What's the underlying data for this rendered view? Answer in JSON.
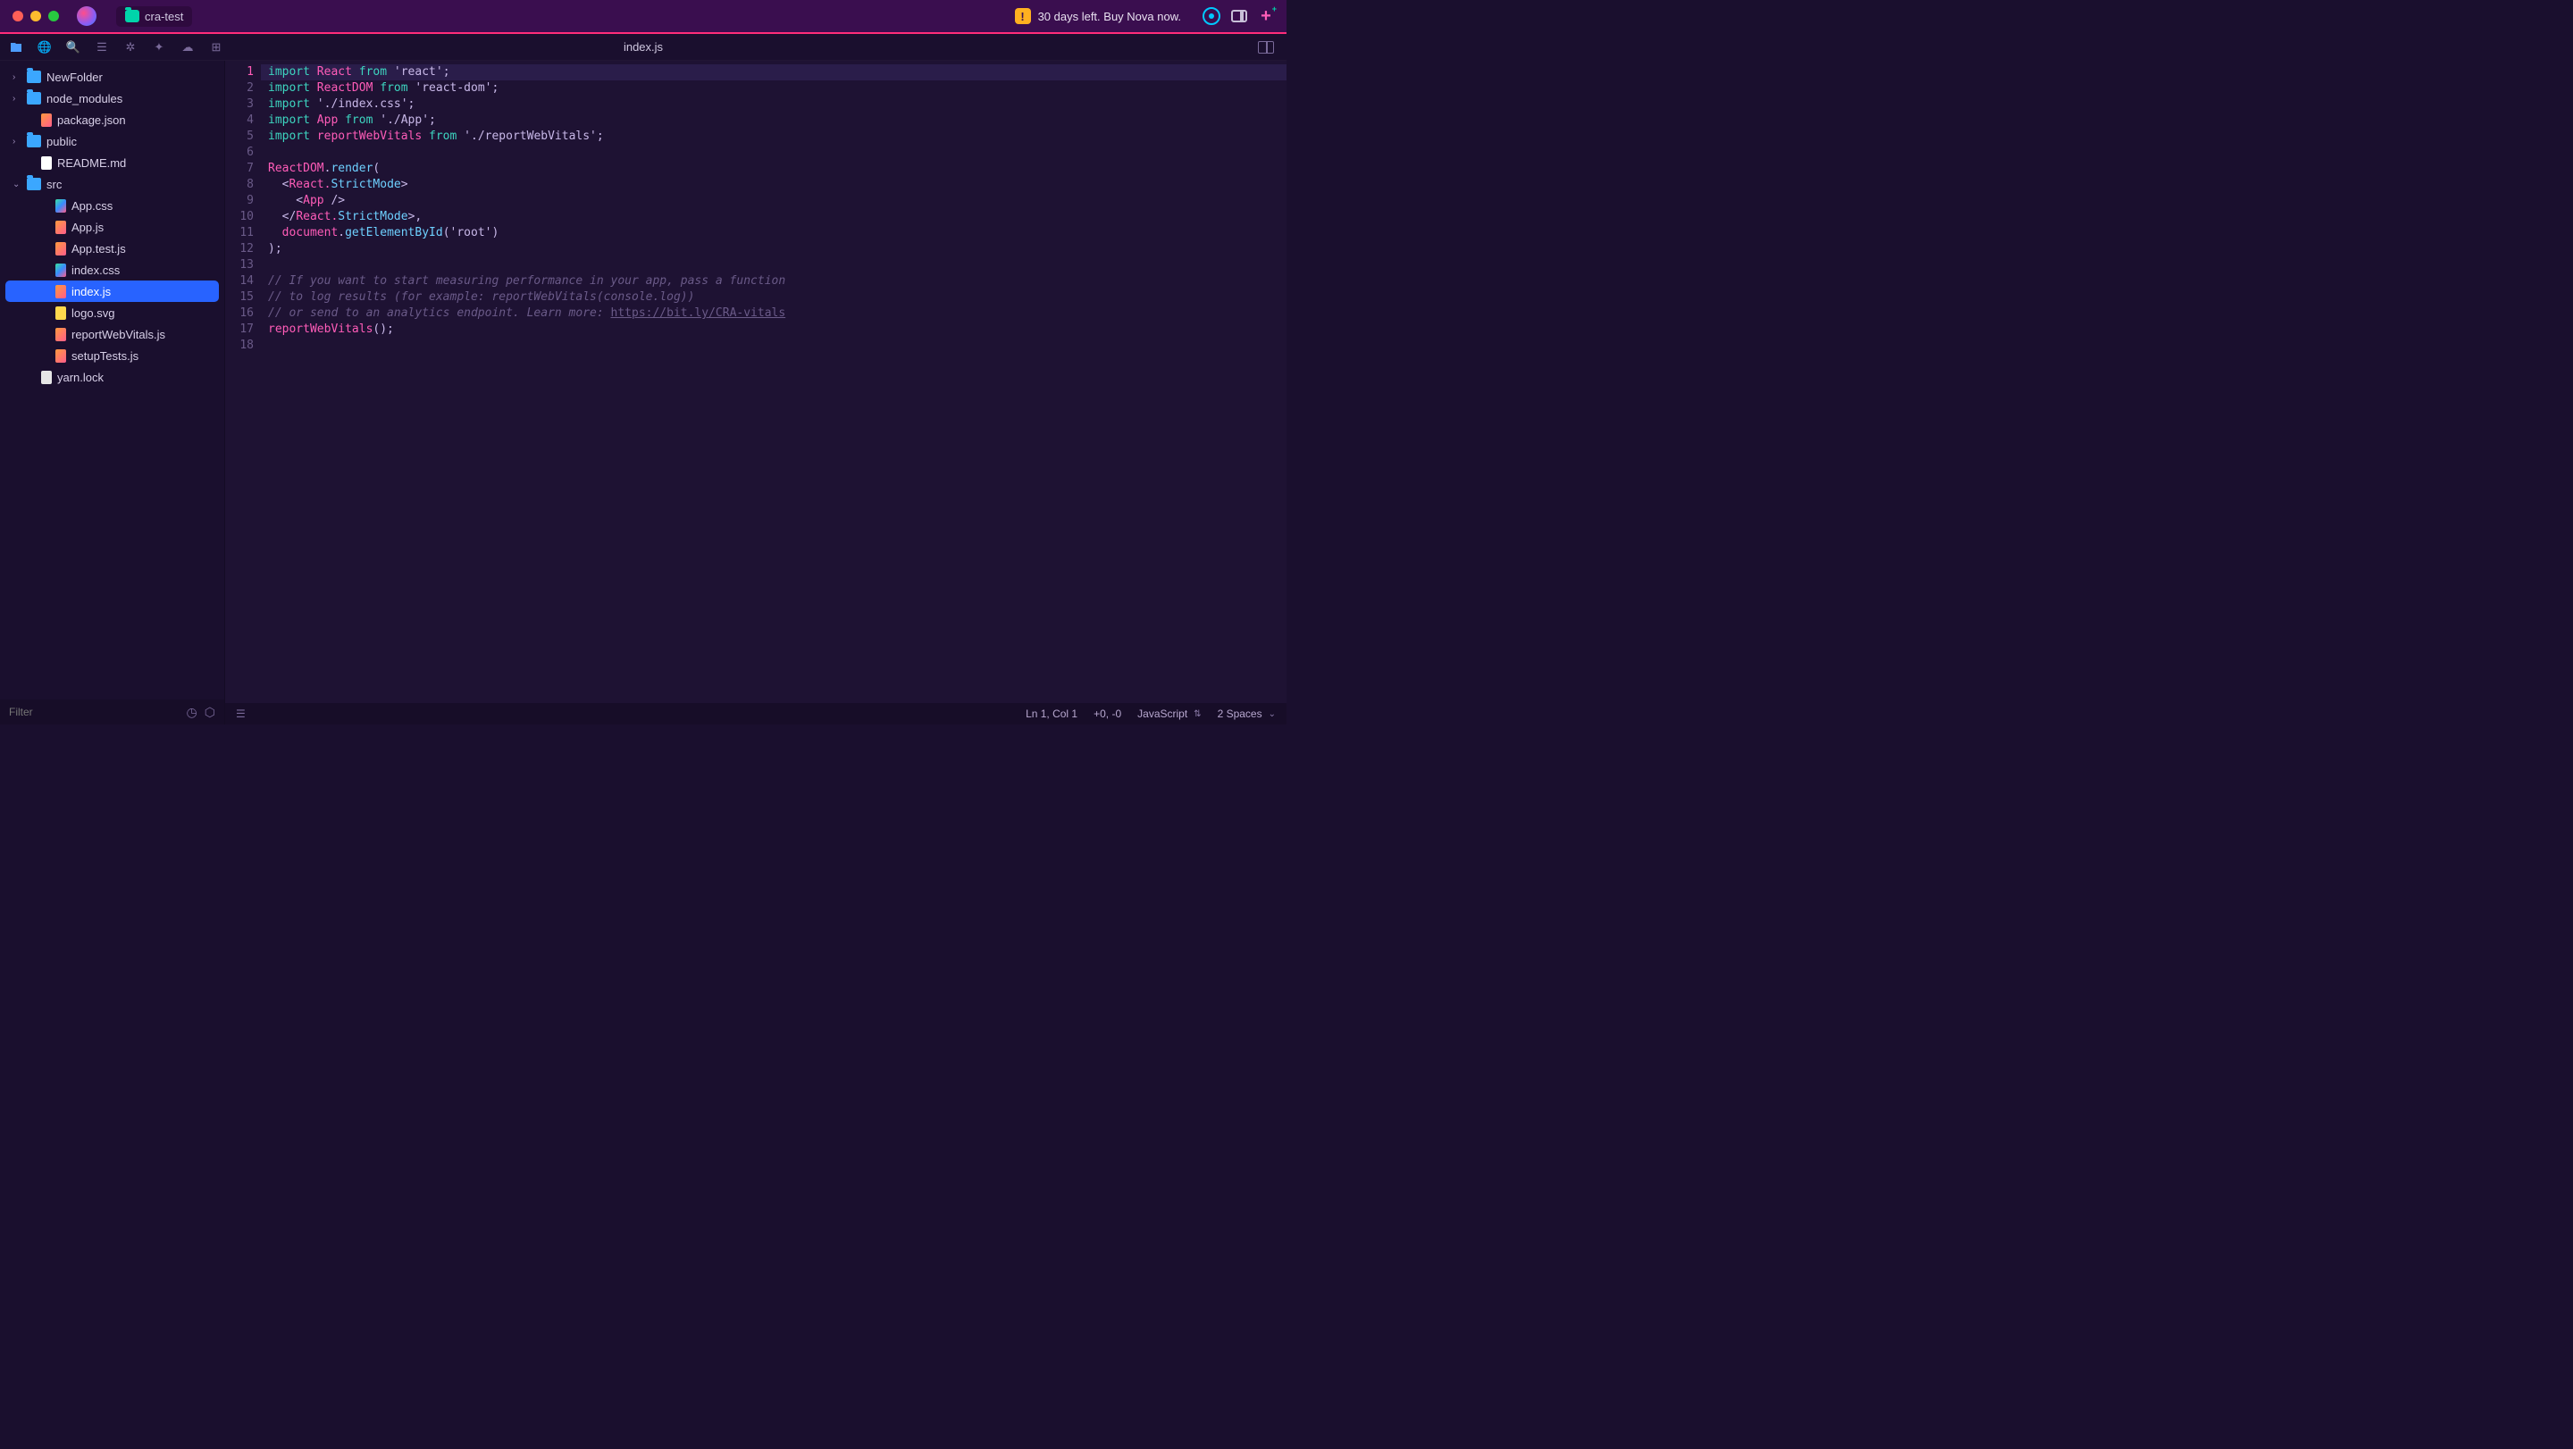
{
  "titlebar": {
    "project_name": "cra-test",
    "trial_text": "30 days left. Buy Nova now."
  },
  "toolbar": {
    "active_tab": "index.js"
  },
  "sidebar": {
    "filter_placeholder": "Filter",
    "tree": [
      {
        "type": "folder",
        "name": "NewFolder",
        "depth": 0,
        "expanded": false,
        "chev": true
      },
      {
        "type": "folder",
        "name": "node_modules",
        "depth": 0,
        "expanded": false,
        "chev": true
      },
      {
        "type": "file",
        "name": "package.json",
        "icon": "js",
        "depth": 1,
        "chev": false
      },
      {
        "type": "folder",
        "name": "public",
        "depth": 0,
        "expanded": false,
        "chev": true
      },
      {
        "type": "file",
        "name": "README.md",
        "icon": "generic",
        "depth": 1,
        "chev": false
      },
      {
        "type": "folder",
        "name": "src",
        "depth": 0,
        "expanded": true,
        "chev": true
      },
      {
        "type": "file",
        "name": "App.css",
        "icon": "css",
        "depth": 2,
        "chev": false
      },
      {
        "type": "file",
        "name": "App.js",
        "icon": "js",
        "depth": 2,
        "chev": false
      },
      {
        "type": "file",
        "name": "App.test.js",
        "icon": "js",
        "depth": 2,
        "chev": false
      },
      {
        "type": "file",
        "name": "index.css",
        "icon": "css",
        "depth": 2,
        "chev": false
      },
      {
        "type": "file",
        "name": "index.js",
        "icon": "js",
        "depth": 2,
        "chev": false,
        "selected": true
      },
      {
        "type": "file",
        "name": "logo.svg",
        "icon": "svg",
        "depth": 2,
        "chev": false
      },
      {
        "type": "file",
        "name": "reportWebVitals.js",
        "icon": "js",
        "depth": 2,
        "chev": false
      },
      {
        "type": "file",
        "name": "setupTests.js",
        "icon": "js",
        "depth": 2,
        "chev": false
      },
      {
        "type": "file",
        "name": "yarn.lock",
        "icon": "lock",
        "depth": 1,
        "chev": false
      }
    ]
  },
  "editor": {
    "line_count": 18,
    "current_line": 1,
    "lines": [
      [
        {
          "c": "k",
          "t": "import"
        },
        {
          "c": "p",
          "t": " "
        },
        {
          "c": "id",
          "t": "React"
        },
        {
          "c": "p",
          "t": " "
        },
        {
          "c": "k",
          "t": "from"
        },
        {
          "c": "p",
          "t": " "
        },
        {
          "c": "str",
          "t": "'react'"
        },
        {
          "c": "p",
          "t": ";"
        }
      ],
      [
        {
          "c": "k",
          "t": "import"
        },
        {
          "c": "p",
          "t": " "
        },
        {
          "c": "id",
          "t": "ReactDOM"
        },
        {
          "c": "p",
          "t": " "
        },
        {
          "c": "k",
          "t": "from"
        },
        {
          "c": "p",
          "t": " "
        },
        {
          "c": "str",
          "t": "'react-dom'"
        },
        {
          "c": "p",
          "t": ";"
        }
      ],
      [
        {
          "c": "k",
          "t": "import"
        },
        {
          "c": "p",
          "t": " "
        },
        {
          "c": "str",
          "t": "'./index.css'"
        },
        {
          "c": "p",
          "t": ";"
        }
      ],
      [
        {
          "c": "k",
          "t": "import"
        },
        {
          "c": "p",
          "t": " "
        },
        {
          "c": "id",
          "t": "App"
        },
        {
          "c": "p",
          "t": " "
        },
        {
          "c": "k",
          "t": "from"
        },
        {
          "c": "p",
          "t": " "
        },
        {
          "c": "str",
          "t": "'./App'"
        },
        {
          "c": "p",
          "t": ";"
        }
      ],
      [
        {
          "c": "k",
          "t": "import"
        },
        {
          "c": "p",
          "t": " "
        },
        {
          "c": "id",
          "t": "reportWebVitals"
        },
        {
          "c": "p",
          "t": " "
        },
        {
          "c": "k",
          "t": "from"
        },
        {
          "c": "p",
          "t": " "
        },
        {
          "c": "str",
          "t": "'./reportWebVitals'"
        },
        {
          "c": "p",
          "t": ";"
        }
      ],
      [],
      [
        {
          "c": "id",
          "t": "ReactDOM"
        },
        {
          "c": "p",
          "t": "."
        },
        {
          "c": "fn",
          "t": "render"
        },
        {
          "c": "p",
          "t": "("
        }
      ],
      [
        {
          "c": "p",
          "t": "  <"
        },
        {
          "c": "tag",
          "t": "React."
        },
        {
          "c": "attr",
          "t": "StrictMode"
        },
        {
          "c": "p",
          "t": ">"
        }
      ],
      [
        {
          "c": "p",
          "t": "    <"
        },
        {
          "c": "tag",
          "t": "App"
        },
        {
          "c": "p",
          "t": " />"
        }
      ],
      [
        {
          "c": "p",
          "t": "  </"
        },
        {
          "c": "tag",
          "t": "React."
        },
        {
          "c": "attr",
          "t": "StrictMode"
        },
        {
          "c": "p",
          "t": ">,"
        }
      ],
      [
        {
          "c": "p",
          "t": "  "
        },
        {
          "c": "id",
          "t": "document"
        },
        {
          "c": "p",
          "t": "."
        },
        {
          "c": "fn",
          "t": "getElementById"
        },
        {
          "c": "p",
          "t": "("
        },
        {
          "c": "str",
          "t": "'root'"
        },
        {
          "c": "p",
          "t": ")"
        }
      ],
      [
        {
          "c": "p",
          "t": ");"
        }
      ],
      [],
      [
        {
          "c": "cm",
          "t": "// If you want to start measuring performance in your app, pass a function"
        }
      ],
      [
        {
          "c": "cm",
          "t": "// to log results (for example: reportWebVitals(console.log))"
        }
      ],
      [
        {
          "c": "cm",
          "t": "// or send to an analytics endpoint. Learn more: "
        },
        {
          "c": "url",
          "t": "https://bit.ly/CRA-vitals"
        }
      ],
      [
        {
          "c": "id",
          "t": "reportWebVitals"
        },
        {
          "c": "p",
          "t": "();"
        }
      ],
      []
    ]
  },
  "status": {
    "position": "Ln 1, Col 1",
    "changes": "+0, -0",
    "language": "JavaScript",
    "indent": "2 Spaces"
  }
}
